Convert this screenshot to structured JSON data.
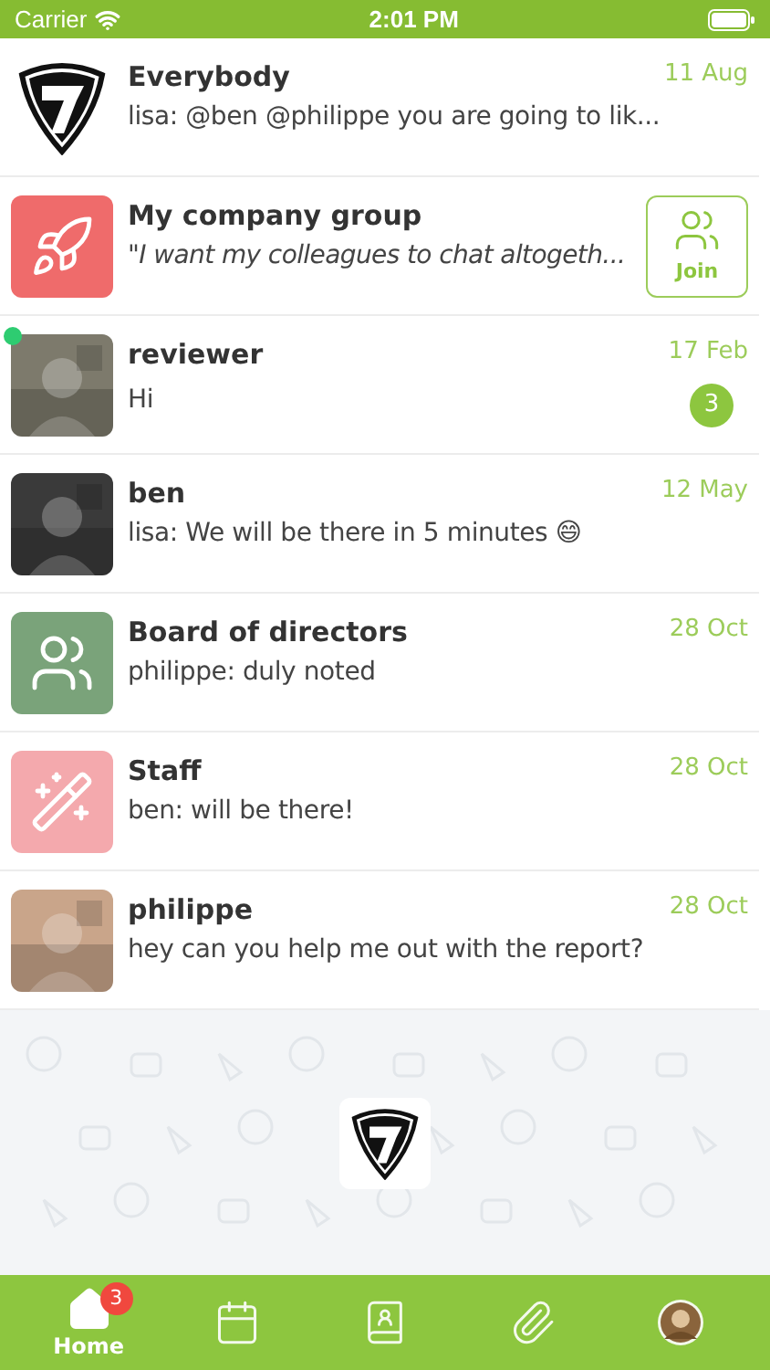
{
  "status_bar": {
    "carrier": "Carrier",
    "time": "2:01 PM"
  },
  "chats": [
    {
      "avatar": {
        "kind": "logo"
      },
      "name": "Everybody",
      "message": "lisa: @ben @philippe you are going to lik...",
      "date": "11 Aug",
      "kind": "chat"
    },
    {
      "avatar": {
        "kind": "rocket",
        "color": "#ef6b6b"
      },
      "name": "My company group",
      "message": "\"I want my colleagues to chat altogeth...",
      "kind": "invite",
      "action": "Join"
    },
    {
      "name": "reviewer",
      "message": "Hi",
      "date": "17 Feb",
      "kind": "chat",
      "online": true,
      "unread": "3"
    },
    {
      "name": "ben",
      "message": "lisa: We will be there in 5 minutes 😄",
      "date": "12 May",
      "kind": "chat"
    },
    {
      "avatar": {
        "kind": "people",
        "color": "#7aa37a"
      },
      "name": "Board of directors",
      "message": "philippe: duly noted",
      "date": "28 Oct",
      "kind": "chat"
    },
    {
      "avatar": {
        "kind": "wand",
        "color": "#f4a9ad"
      },
      "name": "Staff",
      "message": "ben: will be there!",
      "date": "28 Oct",
      "kind": "chat"
    },
    {
      "name": "philippe",
      "message": "hey can you help me out with the report?",
      "date": "28 Oct",
      "kind": "chat"
    }
  ],
  "tabs": [
    {
      "kind": "home",
      "label": "Home",
      "selected": true,
      "badge": "3"
    },
    {
      "kind": "calendar",
      "selected": false
    },
    {
      "kind": "contacts",
      "selected": false
    },
    {
      "kind": "attachment",
      "selected": false
    },
    {
      "kind": "profile",
      "selected": false
    }
  ]
}
